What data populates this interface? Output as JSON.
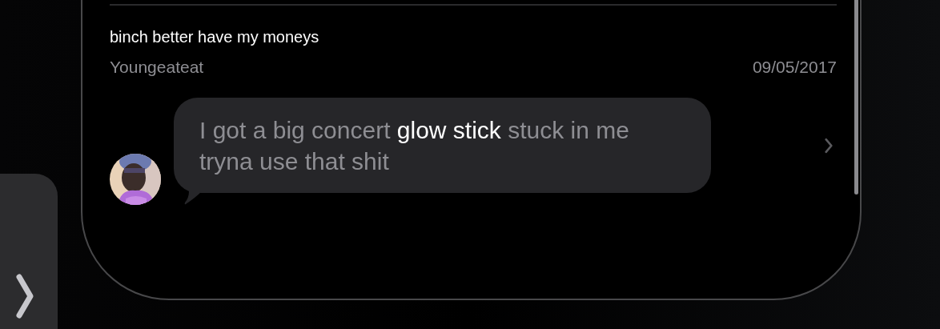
{
  "result": {
    "title": "binch better have my moneys",
    "sender": "Youngeateat",
    "date": "09/05/2017",
    "message": {
      "segments": [
        {
          "text": "I got a big concert ",
          "highlighted": false
        },
        {
          "text": "glow stick",
          "highlighted": true
        },
        {
          "text": " stuck in me tryna use that shit",
          "highlighted": false
        }
      ]
    }
  }
}
